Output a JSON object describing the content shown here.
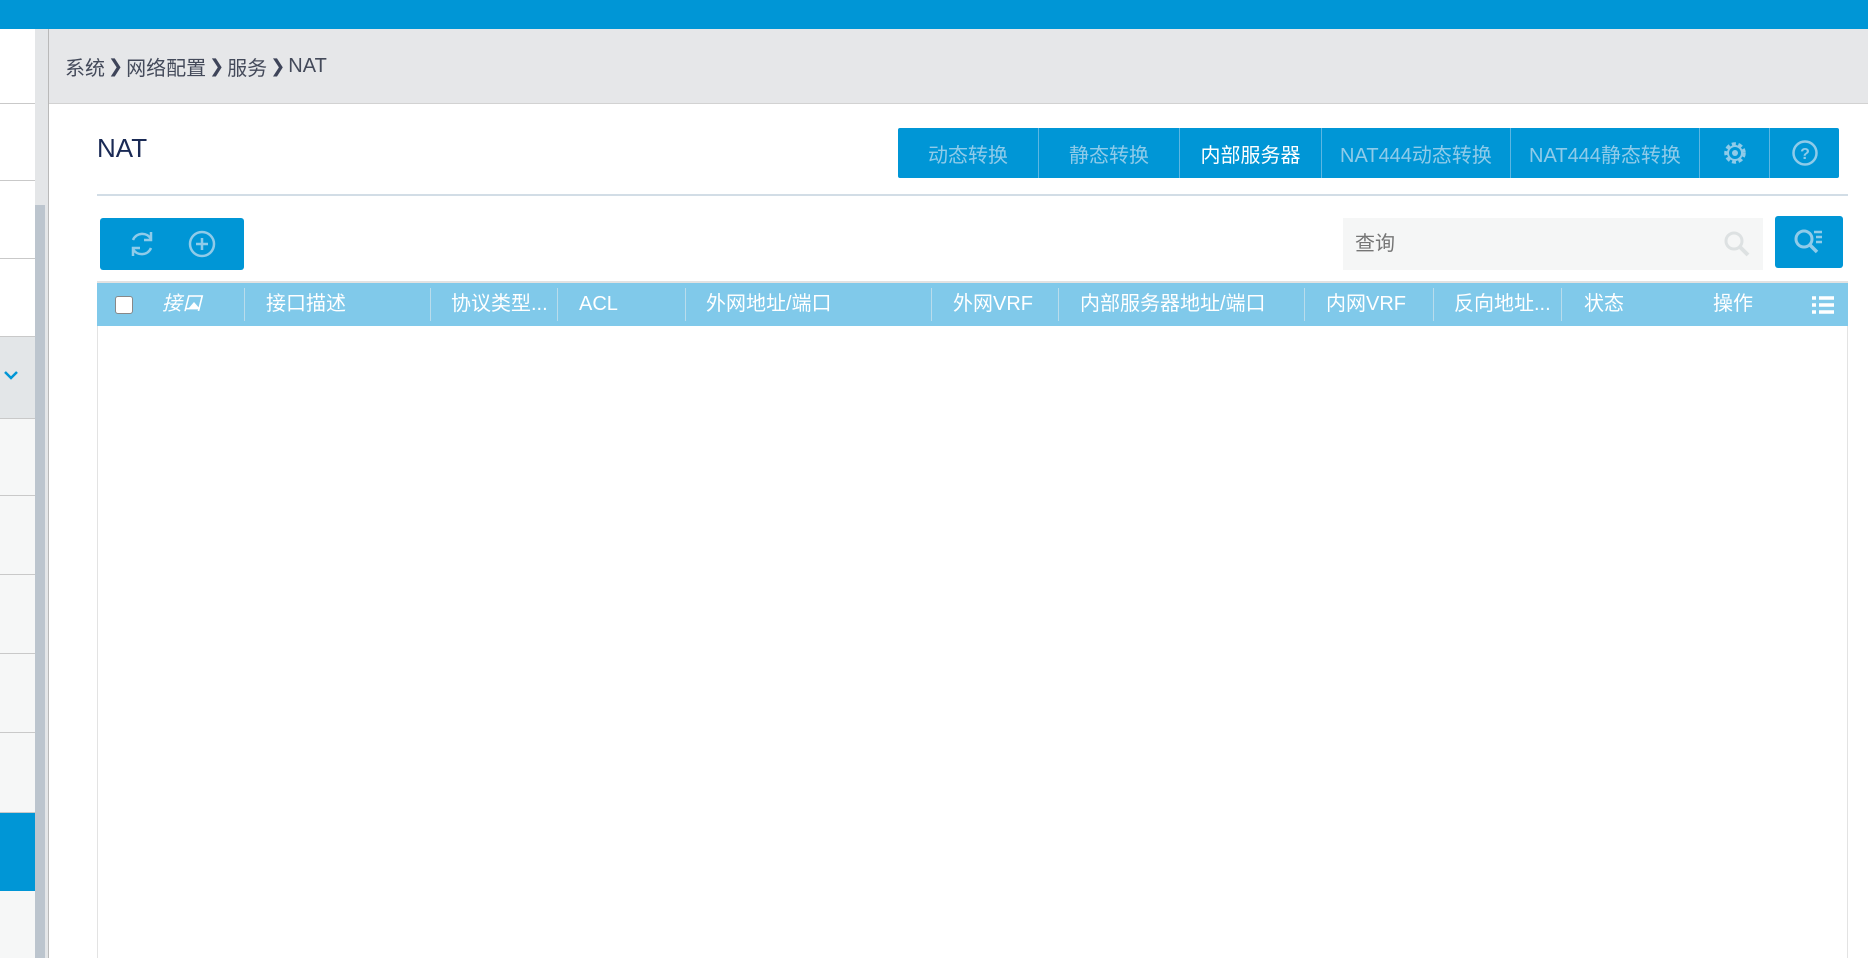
{
  "breadcrumb": [
    "系统",
    "网络配置",
    "服务",
    "NAT"
  ],
  "page_title": "NAT",
  "tabs": [
    {
      "label": "动态转换",
      "active": false
    },
    {
      "label": "静态转换",
      "active": false
    },
    {
      "label": "内部服务器",
      "active": true
    },
    {
      "label": "NAT444动态转换",
      "active": false
    },
    {
      "label": "NAT444静态转换",
      "active": false
    }
  ],
  "search": {
    "placeholder": "查询",
    "value": ""
  },
  "table": {
    "columns": [
      "接口",
      "接口描述",
      "协议类型...",
      "ACL",
      "外网地址/端口",
      "外网VRF",
      "内部服务器地址/端口",
      "内网VRF",
      "反向地址...",
      "状态",
      "操作"
    ],
    "sort_column": "接口",
    "sort_dir": "asc",
    "rows": []
  },
  "colors": {
    "accent": "#0096d6",
    "header": "#80c9ea"
  }
}
